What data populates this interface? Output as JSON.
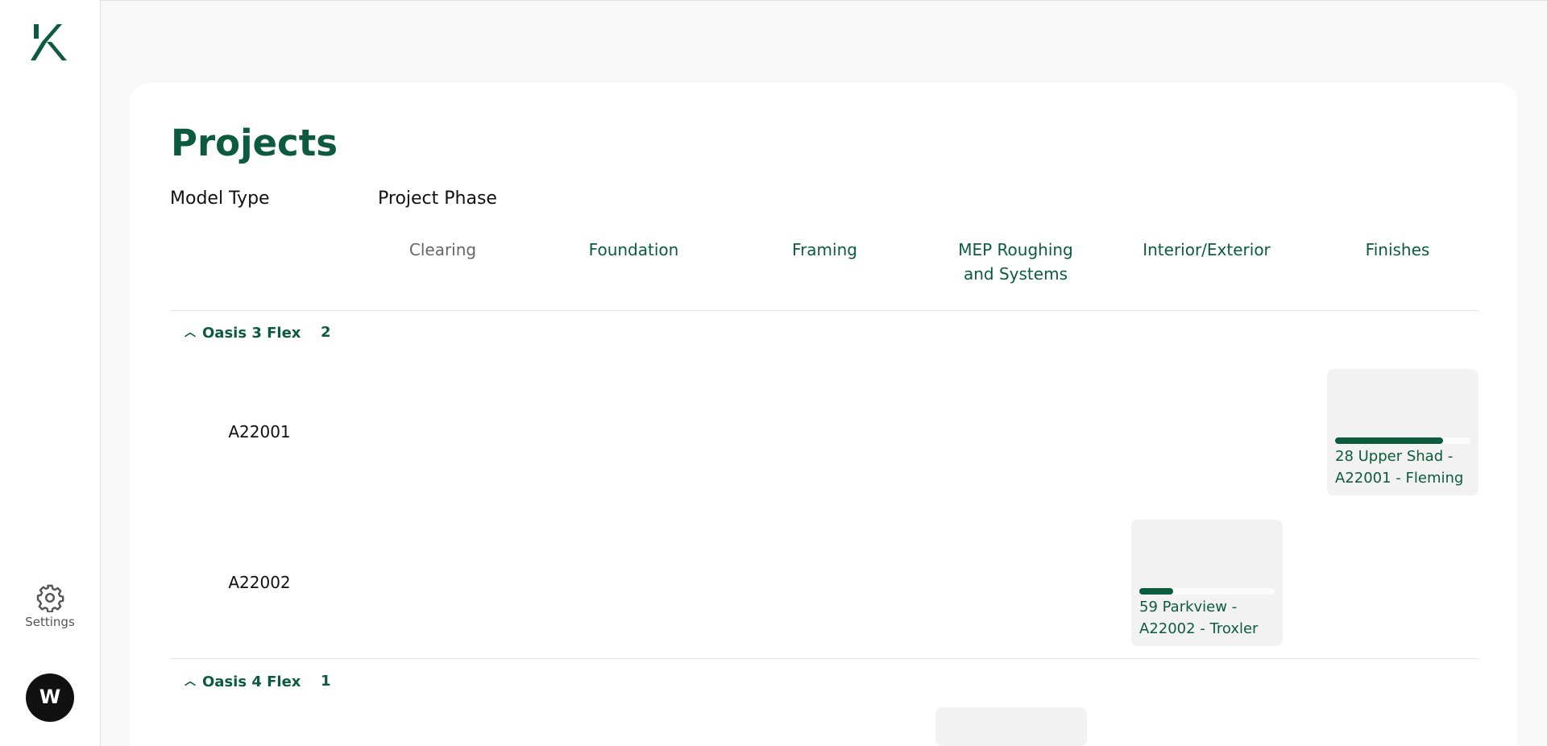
{
  "brand": {
    "logo_icon": "k-logo-icon",
    "brand_color": "#0c5b3e"
  },
  "sidebar": {
    "settings_label": "Settings",
    "settings_icon": "gear-icon",
    "avatar_text": "W"
  },
  "page": {
    "title": "Projects",
    "model_type_label": "Model Type",
    "project_phase_label": "Project Phase"
  },
  "phases": [
    "Clearing",
    "Foundation",
    "Framing",
    "MEP Roughing and Systems",
    "Interior/Exterior",
    "Finishes"
  ],
  "groups": [
    {
      "name": "Oasis 3 Flex",
      "count": "2",
      "models": [
        {
          "id": "A22001",
          "project": {
            "name": "28 Upper Shad - A22001 - Fleming",
            "phase": "Finishes",
            "progress": 0.8
          }
        },
        {
          "id": "A22002",
          "project": {
            "name": "59 Parkview - A22002 - Troxler",
            "phase": "Interior/Exterior",
            "progress": 0.25
          }
        }
      ]
    },
    {
      "name": "Oasis 4 Flex",
      "count": "1",
      "models": []
    }
  ]
}
